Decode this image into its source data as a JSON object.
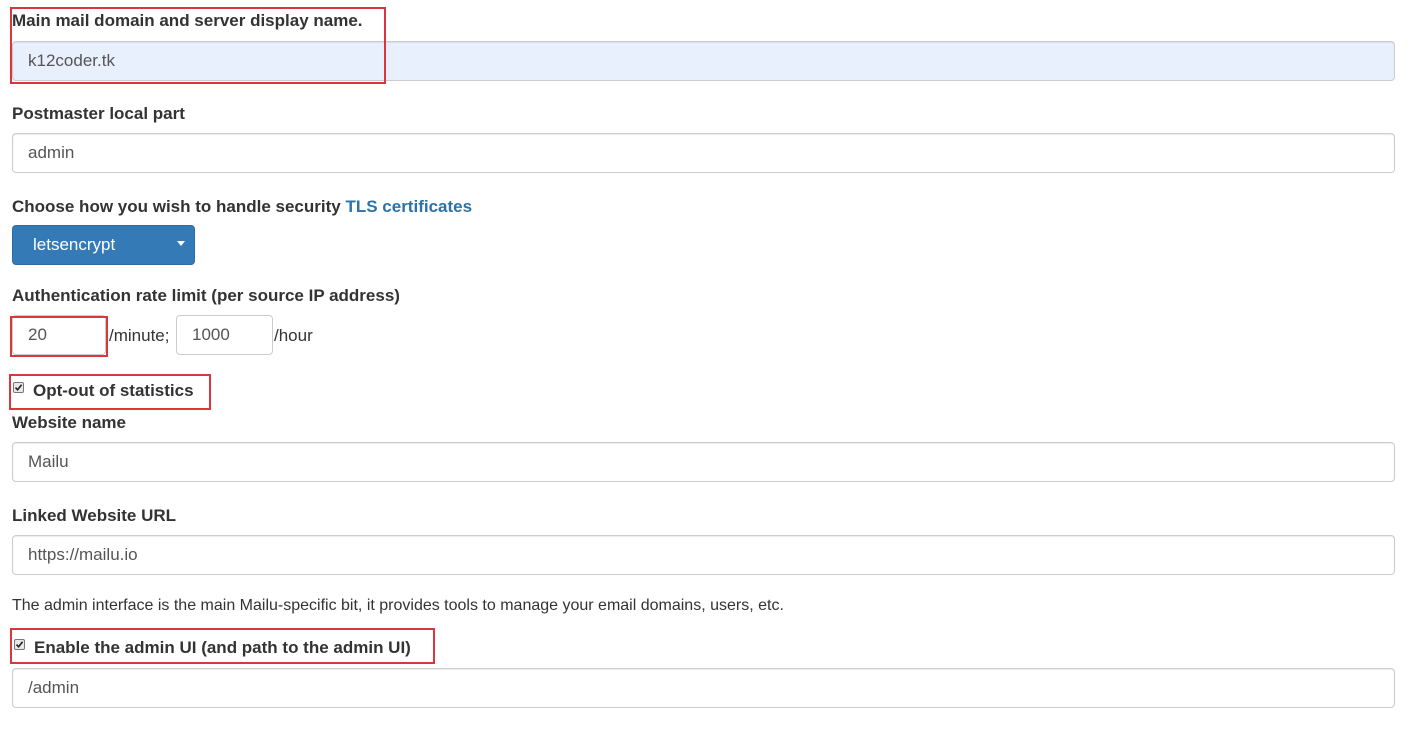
{
  "domain": {
    "label": "Main mail domain and server display name.",
    "value": "k12coder.tk"
  },
  "postmaster": {
    "label": "Postmaster local part",
    "value": "admin"
  },
  "tls": {
    "label_prefix": "Choose how you wish to handle security",
    "label_link": "TLS certificates",
    "selected": "letsencrypt"
  },
  "rate_limit": {
    "label": "Authentication rate limit (per source IP address)",
    "per_minute_value": "20",
    "per_minute_suffix": "/minute;",
    "per_hour_value": "1000",
    "per_hour_suffix": "/hour"
  },
  "statistics": {
    "label": "Opt-out of statistics",
    "checked": true
  },
  "website_name": {
    "label": "Website name",
    "value": "Mailu"
  },
  "website_url": {
    "label": "Linked Website URL",
    "value": "https://mailu.io"
  },
  "admin": {
    "info": "The admin interface is the main Mailu-specific bit, it provides tools to manage your email domains, users, etc.",
    "label": "Enable the admin UI (and path to the admin UI)",
    "checked": true,
    "path_value": "/admin"
  },
  "colors": {
    "highlight": "#d9363e",
    "select_bg": "#337ab7",
    "link": "#2a73a9",
    "autofill_bg": "#e8f0fe"
  }
}
